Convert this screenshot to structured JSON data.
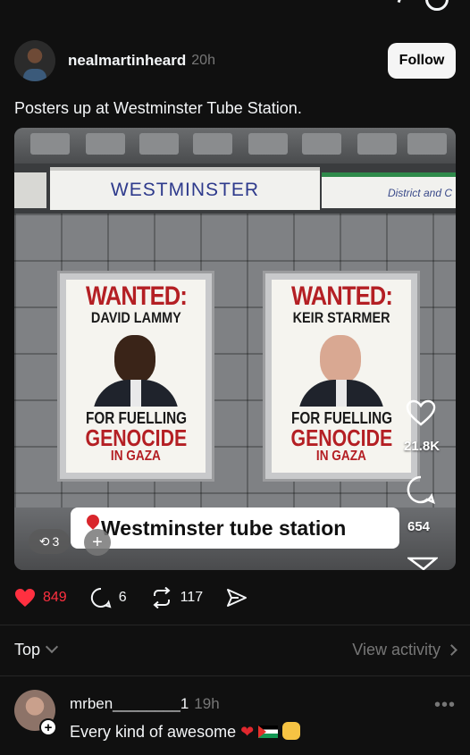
{
  "post": {
    "username": "nealmartinheard",
    "time": "20h",
    "follow_label": "Follow",
    "caption": "Posters up at Westminster Tube Station."
  },
  "media": {
    "station_sign": "WESTMINSTER",
    "line_sign": "District and C",
    "location_tag": "Westminster tube station",
    "remix_count": "3",
    "overlay_likes": "21.8K",
    "overlay_comments": "654",
    "posters": [
      {
        "wanted": "WANTED:",
        "name": "DAVID LAMMY",
        "for": "FOR FUELLING",
        "genocide": "GENOCIDE",
        "gaza": "IN GAZA"
      },
      {
        "wanted": "WANTED:",
        "name": "KEIR STARMER",
        "for": "FOR FUELLING",
        "genocide": "GENOCIDE",
        "gaza": "IN GAZA"
      }
    ]
  },
  "actions": {
    "likes": "849",
    "comments": "6",
    "reposts": "117"
  },
  "filters": {
    "sort_label": "Top",
    "view_activity_label": "View activity"
  },
  "comment": {
    "username": "mrben________1",
    "time": "19h",
    "text": "Every kind of awesome"
  },
  "colors": {
    "background": "#101010",
    "like_red": "#ff3040",
    "poster_red": "#b41f24",
    "muted": "#777777"
  }
}
